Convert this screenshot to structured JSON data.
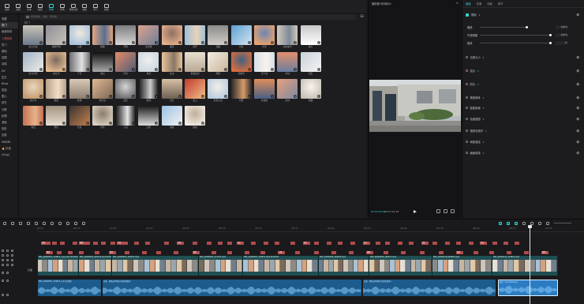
{
  "toolbar": {
    "items": [
      {
        "label": "媒体",
        "icon": "media-icon"
      },
      {
        "label": "音频",
        "icon": "audio-icon"
      },
      {
        "label": "文本",
        "icon": "text-icon"
      },
      {
        "label": "贴纸",
        "icon": "sticker-icon"
      },
      {
        "label": "特效",
        "icon": "effects-icon",
        "active": true
      },
      {
        "label": "转场",
        "icon": "transition-icon"
      },
      {
        "label": "智能动画",
        "icon": "animation-icon"
      },
      {
        "label": "滤镜",
        "icon": "filter-icon"
      },
      {
        "label": "调节",
        "icon": "adjust-icon"
      },
      {
        "label": "模板",
        "icon": "template-icon"
      }
    ]
  },
  "categories": [
    {
      "label": "收藏"
    },
    {
      "label": "热门",
      "selected": true
    },
    {
      "label": "画面特效"
    },
    {
      "label": "人物特效",
      "hot": true
    },
    {
      "label": "热门"
    },
    {
      "label": "基础"
    },
    {
      "label": "氛围"
    },
    {
      "label": "动感"
    },
    {
      "label": "DV"
    },
    {
      "label": "复古"
    },
    {
      "label": "Bling"
    },
    {
      "label": "扭曲"
    },
    {
      "label": "爱心"
    },
    {
      "label": "综艺"
    },
    {
      "label": "分屏"
    },
    {
      "label": "纹理"
    },
    {
      "label": "漫画"
    },
    {
      "label": "投影"
    },
    {
      "label": "边框"
    },
    {
      "label": "MR/MR"
    },
    {
      "label": "🔥 抖音"
    },
    {
      "label": "(Vlog)"
    }
  ],
  "browser": {
    "search_placeholder": "搜索特效、滤镜、转场等",
    "section_title": "热门",
    "filter_icon": "filter-icon"
  },
  "thumbnails": [
    {
      "name": "爱心光斑",
      "c1": "#c9c3b8",
      "c2": "#6d7a8a"
    },
    {
      "name": "模糊开幕",
      "c1": "#8f8f95",
      "c2": "#c9c2bb"
    },
    {
      "name": "心跳",
      "c1": "#a8c4dd",
      "c2": "#f1e8de"
    },
    {
      "name": "模糊",
      "c1": "#e0a582",
      "c2": "#5b6f8f"
    },
    {
      "name": "开幕",
      "c1": "#7d7d80",
      "c2": "#d8d8d8"
    },
    {
      "name": "变清晰",
      "c1": "#dba38e",
      "c2": "#6e7e97"
    },
    {
      "name": "烟花",
      "c1": "#e7b08b",
      "c2": "#8d6e63"
    },
    {
      "name": "落叶",
      "c1": "#9ec0d9",
      "c2": "#e9d2b8"
    },
    {
      "name": "镜像",
      "c1": "#8b8b8b",
      "c2": "#d1cec8"
    },
    {
      "name": "闪白",
      "c1": "#5b9ed0",
      "c2": "#d6e6f2"
    },
    {
      "name": "光晕",
      "c1": "#e9a36c",
      "c2": "#6a87b6"
    },
    {
      "name": "边缘发光",
      "c1": "#d2c9bd",
      "c2": "#7d8a98"
    },
    {
      "name": "胶片",
      "c1": "#c8c8c8",
      "c2": "#ffffff"
    },
    {
      "name": "星光闪烁",
      "c1": "#9fb3c6",
      "c2": "#f0eee8"
    },
    {
      "name": "彩虹光",
      "c1": "#e6b98f",
      "c2": "#7a6b5f"
    },
    {
      "name": "下雪",
      "c1": "#6f6f73",
      "c2": "#e2e2e2"
    },
    {
      "name": "黑白",
      "c1": "#111111",
      "c2": "#aaaaaa"
    },
    {
      "name": "闪光",
      "c1": "#e48b66",
      "c2": "#4f5c78"
    },
    {
      "name": "电光",
      "c1": "#cfd9df",
      "c2": "#eeeeee"
    },
    {
      "name": "复古",
      "c1": "#e9c49b",
      "c2": "#8a7663"
    },
    {
      "name": "灵魂出窍",
      "c1": "#e8e0d2",
      "c2": "#b9a893"
    },
    {
      "name": "雨滴",
      "c1": "#f3ede2",
      "c2": "#c9b49a"
    },
    {
      "name": "录像带",
      "c1": "#db6c3e",
      "c2": "#3f6280"
    },
    {
      "name": "蒸汽波",
      "c1": "#d7dfe6",
      "c2": "#f7f3ee"
    },
    {
      "name": "抖动",
      "c1": "#e38f6c",
      "c2": "#6a7fa1"
    },
    {
      "name": "回忆",
      "c1": "#c9d3d9",
      "c2": "#f4f4f4"
    },
    {
      "name": "倒计时",
      "c1": "#c59c73",
      "c2": "#e8d5bd"
    },
    {
      "name": "撕纸",
      "c1": "#b7a08a",
      "c2": "#f1ddc6"
    },
    {
      "name": "纹理",
      "c1": "#d9c9b6",
      "c2": "#8b7d70"
    },
    {
      "name": "放大镜",
      "c1": "#e1b993",
      "c2": "#7b6754"
    },
    {
      "name": "变焦",
      "c1": "#6a6a6e",
      "c2": "#d6d6d6"
    },
    {
      "name": "玻璃",
      "c1": "#111111",
      "c2": "#cccccc"
    },
    {
      "name": "霓虹",
      "c1": "#d8c1a4",
      "c2": "#6f5f52"
    },
    {
      "name": "萤火",
      "c1": "#c23b2d",
      "c2": "#f0c08a"
    },
    {
      "name": "彩色火焰",
      "c1": "#b9cde0",
      "c2": "#f3eee6"
    },
    {
      "name": "闪屏",
      "c1": "#2c2b2b",
      "c2": "#d69b6a"
    },
    {
      "name": "水波纹",
      "c1": "#e08d5a",
      "c2": "#4a5f86"
    },
    {
      "name": "虚线",
      "c1": "#e7a07a",
      "c2": "#7d89a2"
    },
    {
      "name": "摇摆",
      "c1": "#c9c1b6",
      "c2": "#f7f4ee"
    },
    {
      "name": "渐显",
      "c1": "#c66f51",
      "c2": "#e6b28a"
    },
    {
      "name": "聚焦",
      "c1": "#a49481",
      "c2": "#e6dcd0"
    },
    {
      "name": "光束",
      "c1": "#3a3431",
      "c2": "#c2804f"
    },
    {
      "name": "雪花",
      "c1": "#d8d0c2",
      "c2": "#8c7b69"
    },
    {
      "name": "火焰",
      "c1": "#111111",
      "c2": "#e6e6e6"
    },
    {
      "name": "幻影",
      "c1": "#1b1b1b",
      "c2": "#dddddd"
    },
    {
      "name": "波纹",
      "c1": "#9cc3e3",
      "c2": "#f2f2f2"
    },
    {
      "name": "放射",
      "c1": "#f1ebe2",
      "c2": "#bfae98"
    }
  ],
  "player": {
    "title": "播放器 时间线01",
    "menu_icon": "menu-icon",
    "timecode_current": "00:00:00:00",
    "timecode_total": "00:07:22:18",
    "controls": [
      "play-icon",
      "fullscreen-icon",
      "ratio-icon",
      "zoom-fit-icon"
    ]
  },
  "inspector": {
    "tabs": [
      "画面",
      "变速",
      "动画",
      "调节"
    ],
    "rows": [
      {
        "label": "基础",
        "checked": true
      },
      {
        "label": "位置大小"
      },
      {
        "label": "混合"
      },
      {
        "label": "防抖"
      },
      {
        "label": "美颜美体"
      },
      {
        "label": "智能抠像"
      },
      {
        "label": "色度抠图"
      },
      {
        "label": "视频去频闪"
      },
      {
        "label": "局部重绘"
      },
      {
        "label": "画面增强"
      }
    ],
    "params": [
      {
        "label": "缩放",
        "value": "100%"
      },
      {
        "label": "不透明度",
        "value": "100%"
      },
      {
        "label": "旋转",
        "value": "0°"
      }
    ]
  },
  "timeline": {
    "ruler": [
      "00:00",
      "|00:30",
      "|01:00",
      "|01:30",
      "|02:00",
      "|02:30",
      "|03:00",
      "|03:30",
      "|04:00",
      "|04:30",
      "|05:00",
      "|05:30",
      "|06:00",
      "|06:30",
      "|07:00"
    ],
    "cover_label": "封面",
    "main_clips": [
      {
        "name": "IMG_20240501_154815_copy.mp4 00:00:04"
      },
      {
        "name": "IMG_20240502_091210.mp4 00:00:05"
      },
      {
        "name": "IMG_20240503_183041.mp4"
      },
      {
        "name": "IMG_20240505_171233.mp4"
      },
      {
        "name": "IMG_20240507_102951.mp4 00:00:03"
      },
      {
        "name": "IMG_20240508_140045.mp4"
      },
      {
        "name": "IMG_20240509_160412.mp4"
      },
      {
        "name": "IMG_20240510_083002.mp4"
      },
      {
        "name": "IMG_20240512_191822.mp4"
      }
    ],
    "audio_clips": [
      {
        "name": "IMG_20240501_154815_copy 的音频"
      },
      {
        "name": "日落 · 风吹过的时候 (纯音乐版本)"
      },
      {
        "name": "日落 · 风吹过的时候 (纯音乐版本)"
      },
      {
        "name": "录音 · Good Evening"
      }
    ],
    "effects_labels": [
      "变焦",
      "模糊",
      "开幕",
      "光晕",
      "闪白",
      "胶片",
      "复古",
      "回忆",
      "抖动",
      "聚焦",
      "雪花",
      "烟花",
      "心跳",
      "镜像"
    ]
  },
  "colors": {
    "accent": "#2fd4d0",
    "clip_video": "#1f4f52",
    "clip_audio": "#1c5b8c",
    "effect_marker": "#b04c4c"
  }
}
